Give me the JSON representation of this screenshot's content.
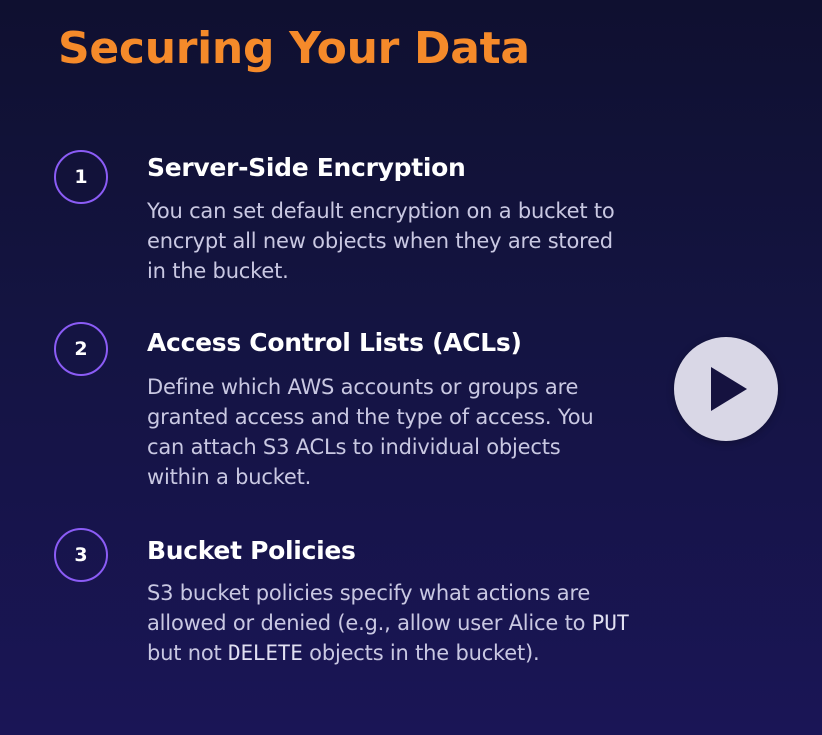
{
  "slide": {
    "title": "Securing Your Data"
  },
  "items": [
    {
      "number": "1",
      "heading": "Server-Side Encryption",
      "body_lines": [
        "You can set default encryption on a bucket to",
        "encrypt all new objects when they are stored",
        "in the bucket."
      ]
    },
    {
      "number": "2",
      "heading": "Access Control Lists (ACLs)",
      "body_lines": [
        "Define which AWS accounts or groups are",
        "granted access and the type of access. You",
        "can attach S3 ACLs to individual objects",
        "within a bucket."
      ]
    },
    {
      "number": "3",
      "heading": "Bucket Policies",
      "body_parts": {
        "line1": "S3 bucket policies specify what actions are",
        "line2_pre": "allowed or denied (e.g., allow user Alice to ",
        "line2_code": "PUT",
        "line3_pre": "but not ",
        "line3_code": "DELETE",
        "line3_post": " objects in the bucket)."
      }
    }
  ],
  "player": {
    "icon": "play-icon"
  },
  "colors": {
    "title": "#f58a2a",
    "circle_border": "#8b5cf6",
    "background_top": "#0f1030",
    "background_bottom": "#1a1556"
  }
}
